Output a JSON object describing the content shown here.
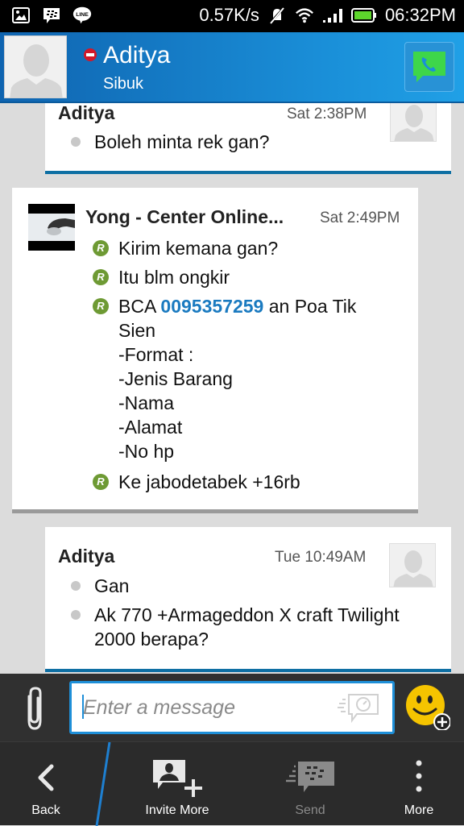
{
  "statusbar": {
    "notification_icons": [
      "gallery-icon",
      "bbm-icon",
      "line-icon"
    ],
    "network_speed": "0.57K/s",
    "time": "06:32PM",
    "battery_color": "#5dd62c"
  },
  "header": {
    "contact_name": "Aditya",
    "status": "Sibuk",
    "status_color": "#d2182a",
    "call_button_icon": "voice-call-icon"
  },
  "colors": {
    "accent_blue": "#1e8fd8",
    "link": "#1a7ac0",
    "read_badge": "#6e9a34",
    "my_card_border": "#0e6fa3"
  },
  "messages": [
    {
      "sender": "Aditya",
      "time": "Sat 2:38PM",
      "side": "mine",
      "lines": [
        {
          "bullet": "sent",
          "text": "Boleh minta rek gan?"
        }
      ]
    },
    {
      "sender": "Yong - Center Online...",
      "time": "Sat 2:49PM",
      "side": "theirs",
      "lines": [
        {
          "bullet": "R",
          "text": "Kirim kemana gan?"
        },
        {
          "bullet": "R",
          "text": "Itu blm ongkir"
        },
        {
          "bullet": "R",
          "prefix": "BCA ",
          "link": "0095357259",
          "suffix": " an Poa Tik Sien",
          "continuation": "-Format :\n-Jenis Barang\n-Nama\n-Alamat\n-No hp"
        },
        {
          "bullet": "R",
          "text": "Ke jabodetabek +16rb"
        }
      ]
    },
    {
      "sender": "Aditya",
      "time": "Tue 10:49AM",
      "side": "mine",
      "lines": [
        {
          "bullet": "sent",
          "text": "Gan"
        },
        {
          "bullet": "sent",
          "text": "Ak 770 +Armageddon X craft Twilight 2000  berapa?"
        }
      ]
    }
  ],
  "composer": {
    "placeholder": "Enter a message",
    "value": ""
  },
  "actionbar": {
    "back": "Back",
    "invite_more": "Invite More",
    "send": "Send",
    "more": "More"
  }
}
